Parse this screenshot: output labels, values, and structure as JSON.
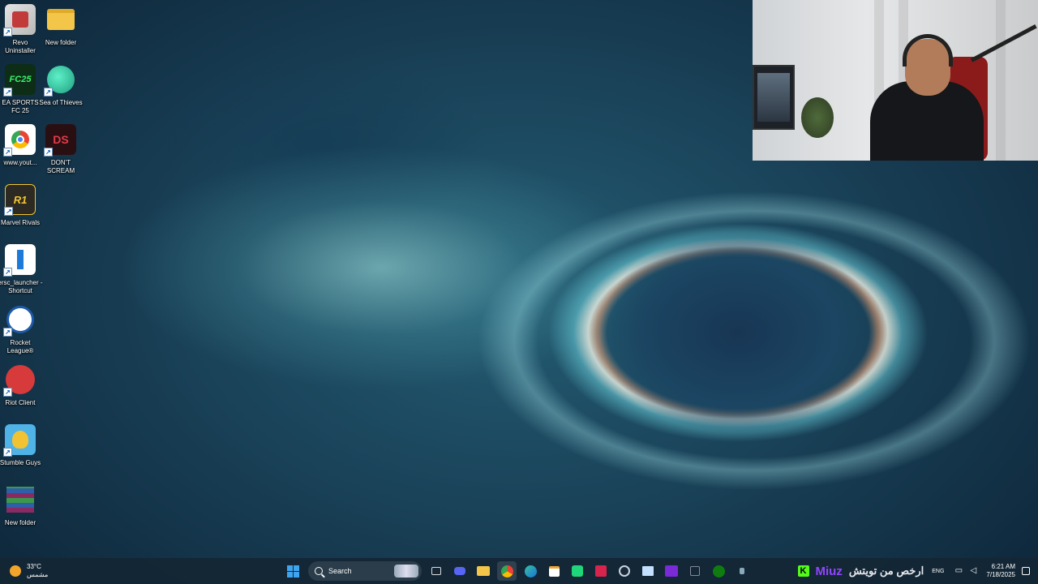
{
  "desktop_icons": [
    {
      "label": "Revo Uninstaller",
      "icon": "revo-uninstaller-icon",
      "color": "#c23b3b"
    },
    {
      "label": "New folder",
      "icon": "folder-icon",
      "color": "#f3c548"
    },
    {
      "label": "EA SPORTS FC 25",
      "icon": "ea-fc25-icon",
      "color": "#0d2d16",
      "glyph": "FC25"
    },
    {
      "label": "Sea of Thieves",
      "icon": "sea-of-thieves-icon",
      "color": "#1f9e7e"
    },
    {
      "label": "www.yout...",
      "icon": "chrome-shortcut-icon",
      "color": "#ffffff"
    },
    {
      "label": "DON'T SCREAM",
      "icon": "dont-scream-icon",
      "color": "#2a0f12",
      "glyph": "DS"
    },
    {
      "label": "Marvel Rivals",
      "icon": "marvel-rivals-icon",
      "color": "#2c2a22",
      "glyph": "R1"
    },
    {
      "label": "ersc_launcher - Shortcut",
      "icon": "ersc-launcher-icon",
      "color": "#ffffff"
    },
    {
      "label": "Rocket League®",
      "icon": "rocket-league-icon",
      "color": "#1d5aa8"
    },
    {
      "label": "Riot Client",
      "icon": "riot-client-icon",
      "color": "#d63a3a"
    },
    {
      "label": "Stumble Guys",
      "icon": "stumble-guys-icon",
      "color": "#4fb3e8"
    },
    {
      "label": "New folder",
      "icon": "winrar-icon",
      "color": "#8a2a62"
    }
  ],
  "taskbar": {
    "weather_temp": "33°C",
    "weather_desc": "مشمس",
    "search_placeholder": "Search",
    "lang": "ENG",
    "time": "6:21 AM",
    "date": "7/18/2025"
  },
  "overlay": {
    "kick_glyph": "K",
    "streamer_name": "Miuz",
    "promo_text": "ارخص من تويتش"
  }
}
